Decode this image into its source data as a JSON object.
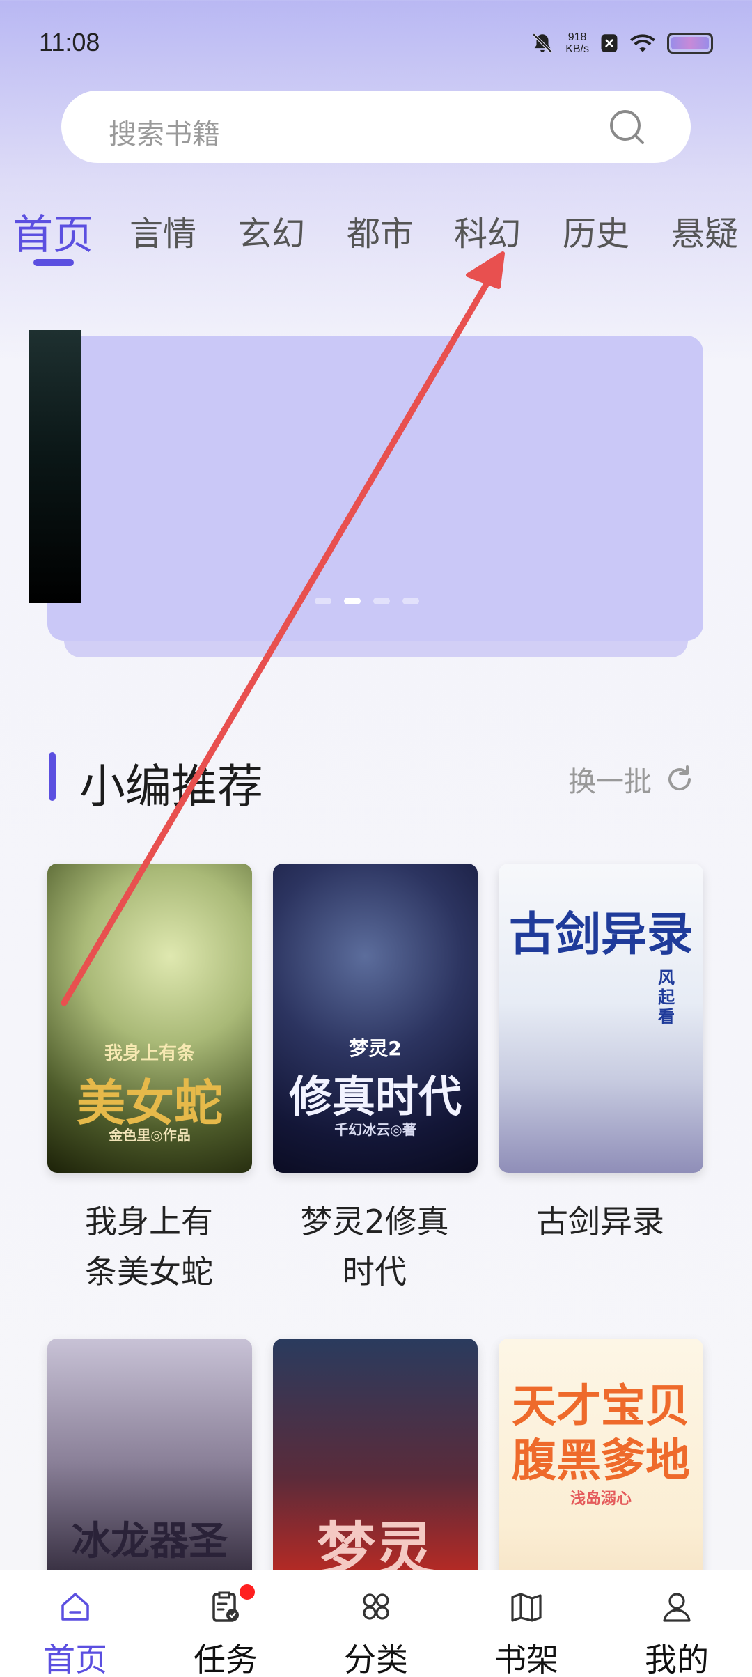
{
  "status_bar": {
    "time": "11:08",
    "net_speed_value": "918",
    "net_speed_unit": "KB/s",
    "icons": [
      "mute-bell-icon",
      "app-notification-icon",
      "wifi-icon",
      "battery-icon"
    ]
  },
  "search": {
    "placeholder": "搜索书籍",
    "icon": "search-icon"
  },
  "tabs": [
    "首页",
    "言情",
    "玄幻",
    "都市",
    "科幻",
    "历史",
    "悬疑"
  ],
  "active_tab_index": 0,
  "banner": {
    "dot_count": 4,
    "active_dot_index": 1
  },
  "recommend": {
    "title": "小编推荐",
    "refresh_label": "换一批",
    "refresh_icon": "refresh-icon"
  },
  "books": [
    {
      "title": "我身上有条美女蛇",
      "title_line1": "我身上有",
      "title_line2": "条美女蛇",
      "cover_top": "我身上有条",
      "cover_main": "美女蛇",
      "cover_author": "金色里◎作品"
    },
    {
      "title": "梦灵2修真时代",
      "title_line1": "梦灵2修真",
      "title_line2": "时代",
      "cover_top": "梦灵2",
      "cover_main": "修真时代",
      "cover_author": "千幻冰云◎著"
    },
    {
      "title": "古剑异录",
      "cover_main": "古剑异录",
      "cover_sub": "风起看"
    },
    {
      "cover_main": "冰龙器圣"
    },
    {
      "cover_main": "梦灵"
    },
    {
      "cover_main_line1": "天才宝贝",
      "cover_main_line2": "腹黑爹地",
      "cover_author": "浅岛溺心"
    }
  ],
  "bottom_nav": [
    {
      "label": "首页",
      "icon": "home-icon",
      "active": true
    },
    {
      "label": "任务",
      "icon": "task-clipboard-icon",
      "badge": true
    },
    {
      "label": "分类",
      "icon": "category-grid-icon"
    },
    {
      "label": "书架",
      "icon": "bookshelf-icon"
    },
    {
      "label": "我的",
      "icon": "profile-icon"
    }
  ],
  "colors": {
    "accent": "#5b4fe0",
    "badge": "#ff1f1f",
    "annotation_arrow": "#e8504f"
  }
}
